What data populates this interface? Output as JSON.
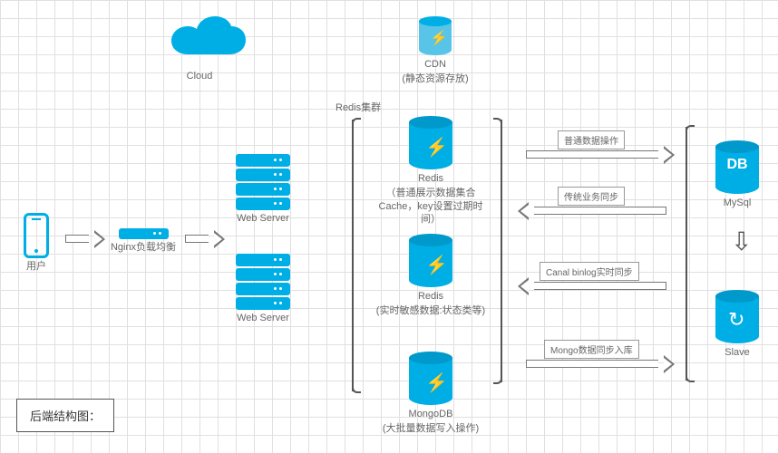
{
  "title": "后端结构图：",
  "nodes": {
    "user": {
      "label": "用户"
    },
    "cloud": {
      "label": "Cloud"
    },
    "nginx": {
      "label": "Nginx负载均衡"
    },
    "webserver1": {
      "label": "Web Server"
    },
    "webserver2": {
      "label": "Web Server"
    },
    "redis_cluster_label": "Redis集群",
    "cdn": {
      "label": "CDN",
      "sub": "(静态资源存放)"
    },
    "redis1": {
      "label": "Redis",
      "sub": "（普通展示数据集合Cache，key设置过期时间）"
    },
    "redis2": {
      "label": "Redis",
      "sub": "(实时敏感数据:状态类等)"
    },
    "mongodb": {
      "label": "MongoDB",
      "sub": "(大批量数据写入操作)"
    },
    "mysql": {
      "label": "MySql",
      "badge": "DB"
    },
    "slave": {
      "label": "Slave"
    }
  },
  "arrows": {
    "a1": "普通数据操作",
    "a2": "传统业务同步",
    "a3": "Canal binlog实时同步",
    "a4": "Mongo数据同步入库"
  }
}
